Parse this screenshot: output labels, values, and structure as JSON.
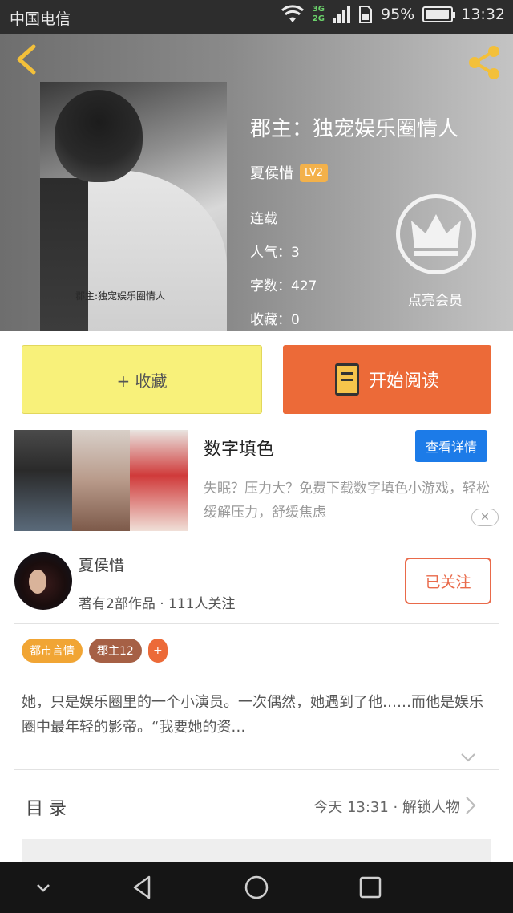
{
  "status_bar": {
    "carrier": "中国电信",
    "network_top": "3G",
    "network_bottom": "2G",
    "battery_text": "95%",
    "battery_level": 0.95,
    "time": "13:32"
  },
  "header": {
    "back_icon": "chevron-left-icon",
    "share_icon": "share-icon"
  },
  "book": {
    "cover_title": "郡主:独宠娱乐圈情人",
    "title": "郡主：独宠娱乐圈情人",
    "author": "夏侯惜",
    "author_level": "LV2",
    "status": "连载",
    "popularity": "人气：3",
    "word_count": "字数：427",
    "favorites": "收藏：0"
  },
  "vip": {
    "icon": "crown-icon",
    "label": "点亮会员"
  },
  "actions": {
    "favorite_label": "+ 收藏",
    "read_label": "开始阅读",
    "read_icon": "book-icon"
  },
  "ad": {
    "title": "数字填色",
    "detail_label": "查看详情",
    "description": "失眠？压力大？免费下载数字填色小游戏，轻松缓解压力，舒缓焦虑",
    "close_label": "✕"
  },
  "author_card": {
    "name": "夏侯惜",
    "stats": "著有2部作品 · 111人关注",
    "follow_label": "已关注"
  },
  "tags": [
    "都市言情",
    "郡主12",
    "+"
  ],
  "synopsis": "她，只是娱乐圈里的一个小演员。一次偶然，她遇到了他……而他是娱乐圈中最年轻的影帝。“我要她的资…",
  "toc": {
    "label": "目 录",
    "latest": "今天 13:31 · 解锁人物"
  },
  "colors": {
    "accent_orange": "#ec6a38",
    "favorite_yellow": "#f8f17a",
    "badge_gold": "#f3b14a",
    "link_blue": "#1c7be8"
  }
}
